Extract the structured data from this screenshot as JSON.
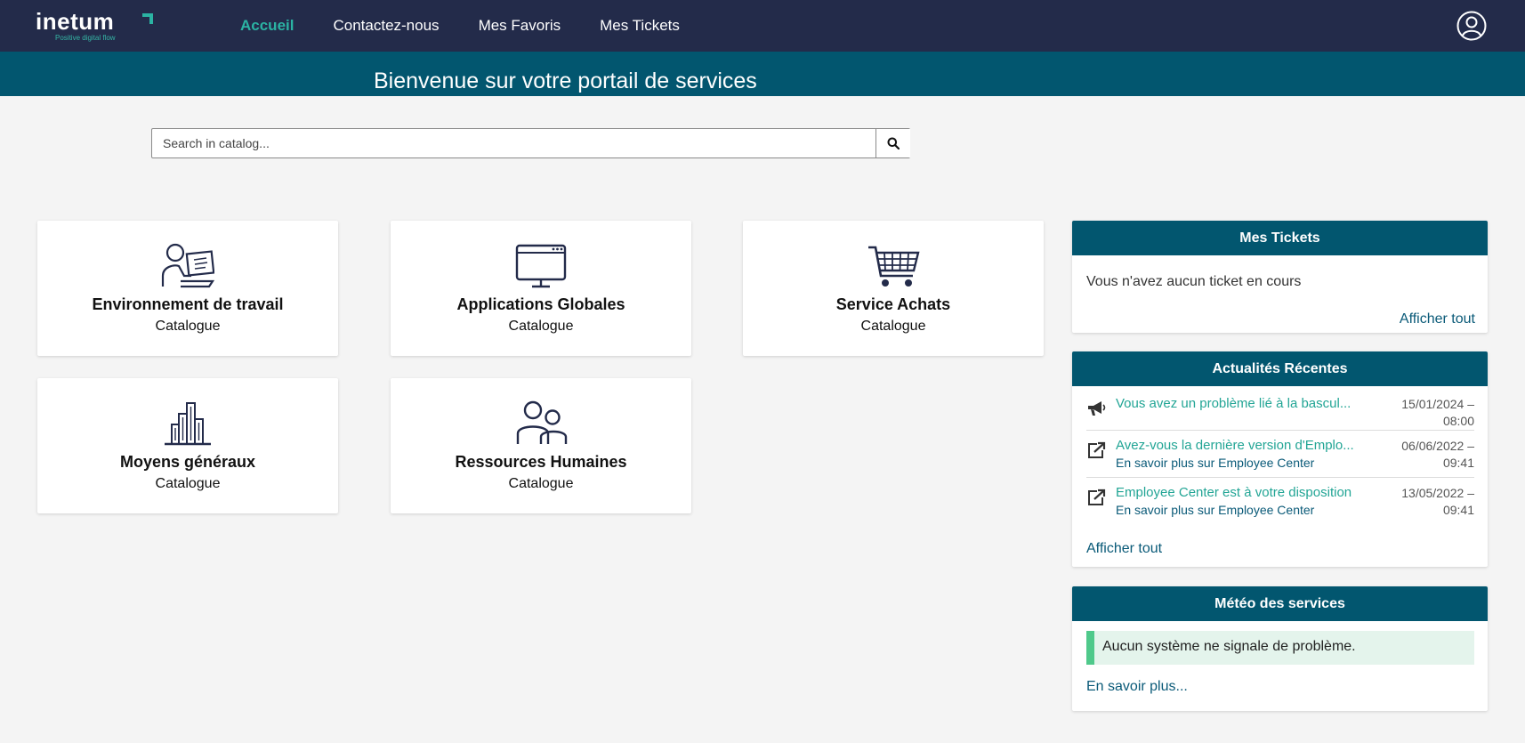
{
  "brand": {
    "name": "inetum",
    "tagline": "Positive digital flow",
    "accent": "#2bb3a3",
    "nav_bg": "#232b4a",
    "banner_bg": "#02566f"
  },
  "nav": {
    "items": [
      {
        "label": "Accueil",
        "active": true
      },
      {
        "label": "Contactez-nous",
        "active": false
      },
      {
        "label": "Mes Favoris",
        "active": false
      },
      {
        "label": "Mes Tickets",
        "active": false
      }
    ],
    "user_icon": "user-circle-icon"
  },
  "banner": {
    "title": "Bienvenue sur votre portail de services"
  },
  "search": {
    "placeholder": "Search in catalog...",
    "value": "",
    "button_icon": "search-icon"
  },
  "catalogs": [
    {
      "title": "Environnement de travail",
      "subtitle": "Catalogue",
      "icon": "person-computer-icon"
    },
    {
      "title": "Applications Globales",
      "subtitle": "Catalogue",
      "icon": "monitor-icon"
    },
    {
      "title": "Service Achats",
      "subtitle": "Catalogue",
      "icon": "shopping-cart-icon"
    },
    {
      "title": "Moyens généraux",
      "subtitle": "Catalogue",
      "icon": "buildings-icon"
    },
    {
      "title": "Ressources Humaines",
      "subtitle": "Catalogue",
      "icon": "people-icon"
    }
  ],
  "tickets_widget": {
    "title": "Mes Tickets",
    "empty_text": "Vous n'avez aucun ticket en cours",
    "view_all": "Afficher tout"
  },
  "news_widget": {
    "title": "Actualités Récentes",
    "items": [
      {
        "title": "Vous avez un problème lié à la bascul...",
        "subtitle": "",
        "date": "15/01/2024 –",
        "time": "08:00",
        "icon": "megaphone-icon"
      },
      {
        "title": "Avez-vous la dernière version d'Emplo...",
        "subtitle": "En savoir plus sur Employee Center",
        "date": "06/06/2022 –",
        "time": "09:41",
        "icon": "external-link-icon"
      },
      {
        "title": "Employee Center est à votre disposition",
        "subtitle": "En savoir plus sur Employee Center",
        "date": "13/05/2022 –",
        "time": "09:41",
        "icon": "external-link-icon"
      }
    ],
    "view_all": "Afficher tout"
  },
  "weather_widget": {
    "title": "Météo des services",
    "status_text": "Aucun système ne signale de problème.",
    "status_color": "#4fc98b",
    "more_link": "En savoir plus..."
  }
}
